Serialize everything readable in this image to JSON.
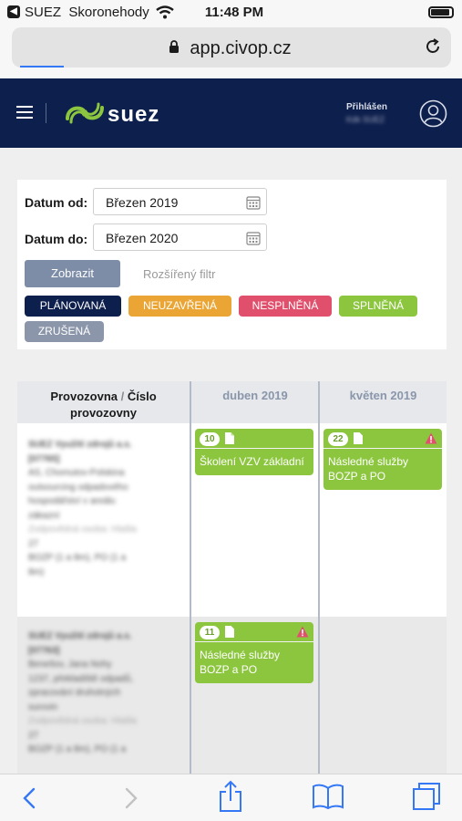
{
  "status_bar": {
    "carrier": "SUEZ",
    "network": "Skoronehody",
    "time": "11:48 PM"
  },
  "browser": {
    "url": "app.civop.cz"
  },
  "header": {
    "logo_text": "suez",
    "logged_in_label": "Přihlášen",
    "user_name": "Kdk SUEZ"
  },
  "filter": {
    "date_from_label": "Datum od:",
    "date_from_value": "Březen 2019",
    "date_to_label": "Datum do:",
    "date_to_value": "Březen 2020",
    "show_button": "Zobrazit",
    "advanced_filter": "Rozšířený filtr",
    "chips": [
      {
        "label": "PLÁNOVANÁ",
        "color": "#0d1f4d"
      },
      {
        "label": "NEUZAVŘENÁ",
        "color": "#eaa534"
      },
      {
        "label": "NESPLNĚNÁ",
        "color": "#e0506d"
      },
      {
        "label": "SPLNĚNÁ",
        "color": "#8cc63f"
      },
      {
        "label": "ZRUŠENÁ",
        "color": "#8c96aa"
      }
    ]
  },
  "table": {
    "col1_header_a": "Provozovna",
    "col1_header_sep": " / ",
    "col1_header_b": "Číslo provozovny",
    "months": [
      "duben 2019",
      "květen 2019"
    ],
    "rows": [
      {
        "place_lines": [
          "SUEZ Využití zdrojů a.s.",
          "[07765]",
          "AS, Chomutov-Polskina",
          "outsourcing odpadového",
          "hospodářství v areálu",
          "zákazní",
          "Zodpovědná osoba: Hlašla",
          "27",
          "BOZP (1 a 8m), PO (1 a",
          "8m)"
        ],
        "april_event": {
          "count": "10",
          "title": "Školení VZV základní"
        },
        "may_event": {
          "count": "22",
          "title": "Následné služby BOZP a PO"
        }
      },
      {
        "place_lines": [
          "SUEZ Využití zdrojů a.s.",
          "[07763]",
          "Benešov, Jana Nohy",
          "1237, překladiště odpadů,",
          "zpracování druhotných",
          "surovin",
          "Zodpovědná osoba: Hlašla",
          "27",
          "BOZP (1 a 8m), PO (1 a"
        ],
        "april_event": {
          "count": "11",
          "title": "Následné služby BOZP a PO"
        }
      }
    ]
  },
  "icons": [
    "back-app-icon",
    "wifi-icon",
    "battery-icon",
    "lock-icon",
    "reload-icon",
    "menu-icon",
    "suez-logo-icon",
    "user-icon",
    "calendar-icon",
    "document-icon",
    "warning-icon",
    "back-arrow-icon",
    "forward-arrow-icon",
    "share-icon",
    "bookmarks-icon",
    "tabs-icon"
  ]
}
